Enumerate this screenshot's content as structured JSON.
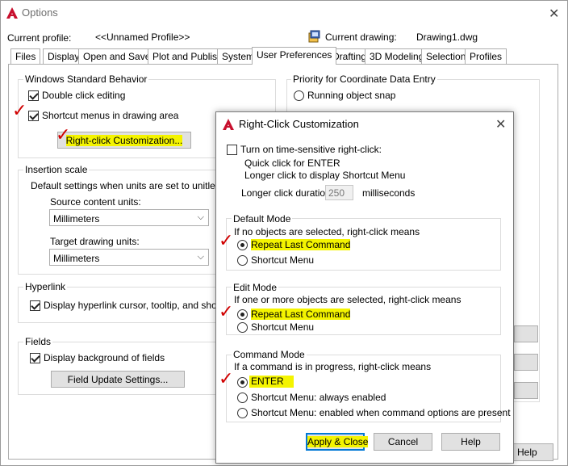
{
  "window": {
    "title": "Options",
    "current_profile_label": "Current profile:",
    "current_profile_value": "<<Unnamed Profile>>",
    "current_drawing_label": "Current drawing:",
    "current_drawing_value": "Drawing1.dwg",
    "tabs": [
      {
        "label": "Files"
      },
      {
        "label": "Display"
      },
      {
        "label": "Open and Save"
      },
      {
        "label": "Plot and Publish"
      },
      {
        "label": "System"
      },
      {
        "label": "User Preferences"
      },
      {
        "label": "Drafting"
      },
      {
        "label": "3D Modeling"
      },
      {
        "label": "Selection"
      },
      {
        "label": "Profiles"
      }
    ],
    "active_tab": "User Preferences"
  },
  "windows_behavior": {
    "title": "Windows Standard Behavior",
    "double_click_label": "Double click editing",
    "double_click_checked": true,
    "shortcut_menus_label": "Shortcut menus in drawing area",
    "shortcut_menus_checked": true,
    "right_click_button": "Right-click Customization..."
  },
  "insertion_scale": {
    "title": "Insertion scale",
    "description": "Default settings when units are set to unitless:",
    "source_label": "Source content units:",
    "source_value": "Millimeters",
    "target_label": "Target drawing units:",
    "target_value": "Millimeters"
  },
  "hyperlink": {
    "title": "Hyperlink",
    "display_label": "Display hyperlink cursor, tooltip, and shortcut m",
    "display_checked": true
  },
  "fields": {
    "title": "Fields",
    "display_bg_label": "Display background of fields",
    "display_bg_checked": true,
    "update_button": "Field Update Settings..."
  },
  "priority": {
    "title": "Priority for Coordinate Data Entry",
    "running_osnap_label": "Running object snap"
  },
  "help_button": "Help",
  "rc_dialog": {
    "title": "Right-Click Customization",
    "time_sensitive_label": "Turn on time-sensitive right-click:",
    "time_sensitive_checked": false,
    "quick_click_text": "Quick click for ENTER",
    "longer_click_text": "Longer click to display Shortcut Menu",
    "duration_label": "Longer click duration:",
    "duration_value": "250",
    "duration_unit": "milliseconds",
    "default_mode": {
      "title": "Default Mode",
      "description": "If no objects are selected, right-click means",
      "options": [
        "Repeat Last Command",
        "Shortcut Menu"
      ],
      "selected": 0
    },
    "edit_mode": {
      "title": "Edit Mode",
      "description": "If one or more objects are selected, right-click means",
      "options": [
        "Repeat Last Command",
        "Shortcut Menu"
      ],
      "selected": 0
    },
    "command_mode": {
      "title": "Command Mode",
      "description": "If a command is in progress, right-click means",
      "options": [
        "ENTER",
        "Shortcut Menu: always enabled",
        "Shortcut Menu: enabled when command options are present"
      ],
      "selected": 0
    },
    "apply_close_button": "Apply & Close",
    "cancel_button": "Cancel",
    "help_button": "Help"
  },
  "colors": {
    "autocad_red": "#c8102e",
    "highlight_yellow": "#f4f400",
    "annotation_red": "#d00000",
    "focus_blue": "#0078d7"
  }
}
